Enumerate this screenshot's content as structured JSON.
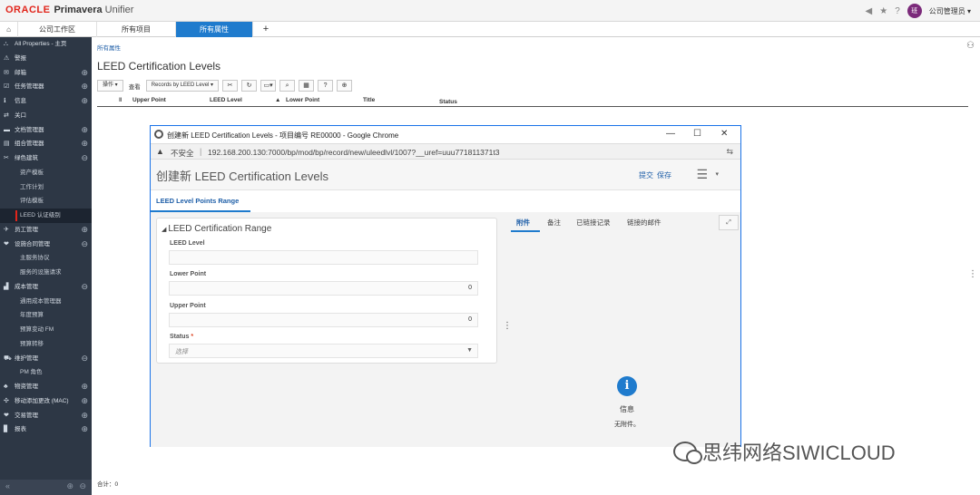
{
  "brand": {
    "oracle": "ORACLE",
    "primavera": "Primavera",
    "unifier": "Unifier"
  },
  "top_right": {
    "user_initial": "班",
    "user_label": "公司管理员 ▾"
  },
  "tabs": {
    "home_icon": "home-icon",
    "items": [
      "公司工作区",
      "所有项目",
      "所有属性"
    ],
    "add": "+"
  },
  "sidebar": {
    "items": [
      {
        "label": "All Properties - 主页",
        "icon": "⛬",
        "pm": ""
      },
      {
        "label": "警报",
        "icon": "⚠",
        "pm": ""
      },
      {
        "label": "邮箱",
        "icon": "✉",
        "pm": "⊕"
      },
      {
        "label": "任务管理器",
        "icon": "☑",
        "pm": "⊕"
      },
      {
        "label": "信息",
        "icon": "ℹ",
        "pm": "⊕"
      },
      {
        "label": "关口",
        "icon": "⇄",
        "pm": ""
      },
      {
        "label": "文档管理器",
        "icon": "▬",
        "pm": "⊕"
      },
      {
        "label": "组合管理器",
        "icon": "▤",
        "pm": "⊕"
      },
      {
        "label": "绿色建筑",
        "icon": "✂",
        "pm": "⊖"
      },
      {
        "label": "资产模板",
        "sub": true
      },
      {
        "label": "工作计划",
        "sub": true
      },
      {
        "label": "评估模板",
        "sub": true
      },
      {
        "label": "LEED 认证级别",
        "sub": true,
        "active": true
      },
      {
        "label": "员工管理",
        "icon": "✈",
        "pm": "⊕"
      },
      {
        "label": "设施合同管理",
        "icon": "❤",
        "pm": "⊖"
      },
      {
        "label": "主服务协议",
        "sub": true
      },
      {
        "label": "服务的设施请求",
        "sub": true
      },
      {
        "label": "成本管理",
        "icon": "▟",
        "pm": "⊖"
      },
      {
        "label": "通用成本管理器",
        "sub": true
      },
      {
        "label": "年度预算",
        "sub": true
      },
      {
        "label": "预算变动 FM",
        "sub": true
      },
      {
        "label": "预算转移",
        "sub": true
      },
      {
        "label": "维护管理",
        "icon": "⛟",
        "pm": "⊖"
      },
      {
        "label": "PM 角色",
        "sub": true
      },
      {
        "label": "物资管理",
        "icon": "♣",
        "pm": "⊕"
      },
      {
        "label": "移动添加更改 (MAC)",
        "icon": "✣",
        "pm": "⊕"
      },
      {
        "label": "交易管理",
        "icon": "❤",
        "pm": "⊕"
      },
      {
        "label": "报表",
        "icon": "▊",
        "pm": "⊕"
      }
    ]
  },
  "main": {
    "breadcrumb": "所有属性",
    "title": "LEED Certification Levels",
    "toolbar": {
      "actions": "操作 ▾",
      "view_label": "查看",
      "view_select": "Records by LEED Level ▾"
    },
    "columns": [
      "Upper Point",
      "LEED Level",
      "Lower Point",
      "Title",
      "Status"
    ],
    "total": "合计：0"
  },
  "chrome": {
    "title": "创建新 LEED Certification Levels - 项目编号 RE00000 - Google Chrome",
    "unsafe": "不安全",
    "url": "192.168.200.130:7000/bp/mod/bp/record/new/uleedlvl/1007?__uref=uuu771811371t3"
  },
  "form": {
    "title": "创建新 LEED Certification Levels",
    "submit": "提交",
    "save": "保存",
    "tab": "LEED Level Points Range",
    "section_title": "LEED Certification Range",
    "fields": {
      "leed_level_label": "LEED Level",
      "leed_level_value": "",
      "lower_point_label": "Lower Point",
      "lower_point_value": "0",
      "upper_point_label": "Upper Point",
      "upper_point_value": "0",
      "status_label": "Status",
      "status_placeholder": "选择"
    },
    "right_tabs": [
      "附件",
      "备注",
      "已链接记录",
      "链接的邮件"
    ],
    "info_title": "信息",
    "info_sub": "无附件。"
  },
  "watermark": "思纬网络SIWICLOUD"
}
